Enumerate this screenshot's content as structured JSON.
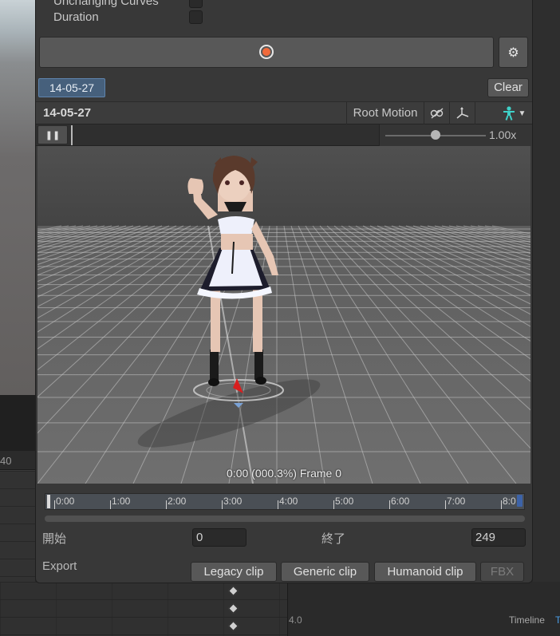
{
  "window": {
    "toggles": [
      {
        "label": "Unchanging Curves",
        "checked": false
      },
      {
        "label": "Duration",
        "checked": false
      }
    ],
    "record_icon": "record-icon",
    "settings_icon": "gear-icon",
    "clip_tag": "14-05-27",
    "clear_label": "Clear"
  },
  "header": {
    "title": "14-05-27",
    "root_motion_label": "Root Motion",
    "icons": [
      "ik-off-icon",
      "pivot-axes-icon",
      "avatar-humanoid-icon",
      "chevron-down-icon"
    ]
  },
  "playbar": {
    "pause_icon": "pause-icon",
    "speed_value": "1.00x",
    "speed_fraction": 0.5
  },
  "viewport": {
    "caption": "0:00 (000.3%) Frame 0",
    "accent_colors": {
      "dress": "#1d1d2c",
      "apron": "#eef0fb",
      "hair": "#5a3a2c",
      "marker": "#d81f1f"
    }
  },
  "timeline": {
    "ticks": [
      "0:00",
      "1:00",
      "2:00",
      "3:00",
      "4:00",
      "5:00",
      "6:00",
      "7:00",
      "8:0"
    ],
    "start_label": "開始",
    "start_value": "0",
    "end_label": "終了",
    "end_value": "249",
    "export_label": "Export",
    "buttons": {
      "legacy": "Legacy clip",
      "generic": "Generic clip",
      "humanoid": "Humanoid clip",
      "fbx": "FBX"
    }
  },
  "background": {
    "left_ruler_value": "40",
    "bottom_ruler_value": "4.0",
    "timeline_tab": "Timeline",
    "timeline_tab_cut": "T"
  }
}
